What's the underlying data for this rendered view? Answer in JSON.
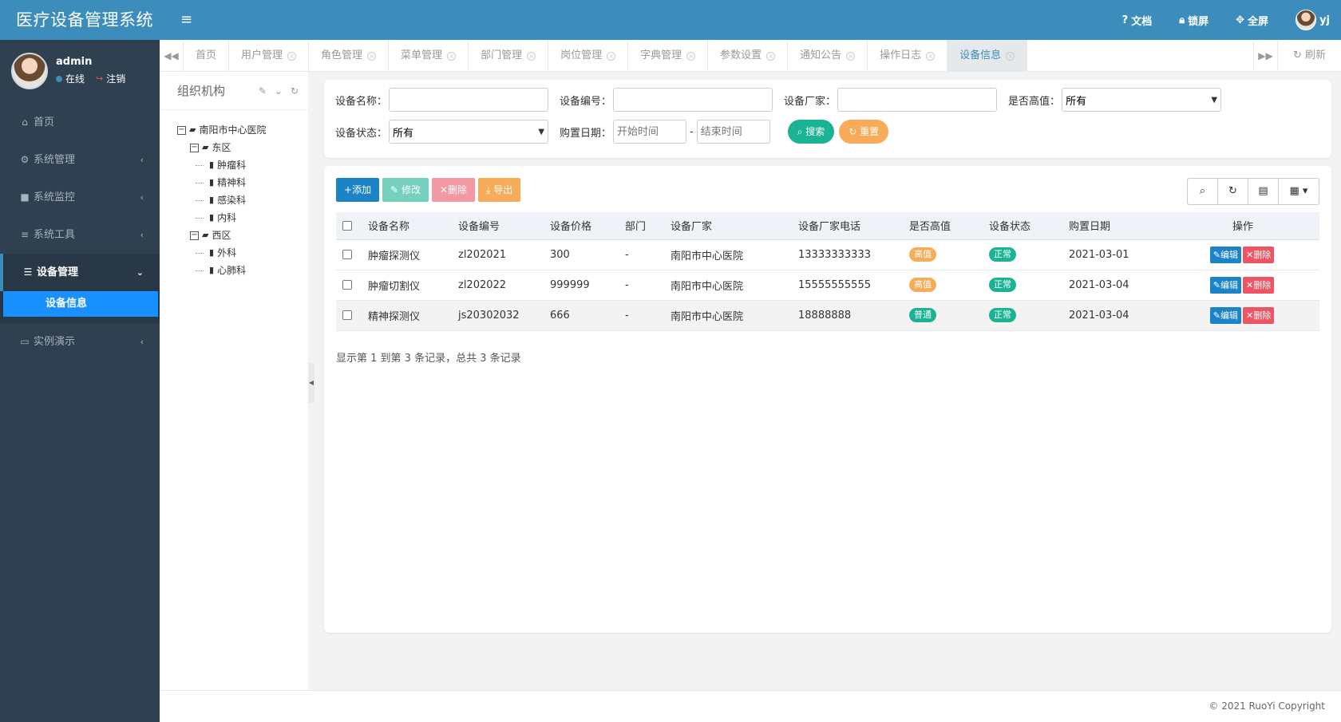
{
  "app": {
    "title": "医疗设备管理系统"
  },
  "user": {
    "name": "admin",
    "status": "在线",
    "logout": "注销",
    "top_name": "yj"
  },
  "topbar": {
    "docs": "文档",
    "lock": "锁屏",
    "fullscreen": "全屏"
  },
  "sidebar": {
    "items": [
      {
        "label": "首页",
        "icon": "home-icon"
      },
      {
        "label": "系统管理",
        "icon": "gear-icon"
      },
      {
        "label": "系统监控",
        "icon": "video-icon"
      },
      {
        "label": "系统工具",
        "icon": "bars-icon"
      },
      {
        "label": "设备管理",
        "icon": "database-icon"
      },
      {
        "label": "实例演示",
        "icon": "desktop-icon"
      }
    ],
    "sub_active": "设备信息"
  },
  "tabs": [
    "首页",
    "用户管理",
    "角色管理",
    "菜单管理",
    "部门管理",
    "岗位管理",
    "字典管理",
    "参数设置",
    "通知公告",
    "操作日志",
    "设备信息"
  ],
  "tabs_refresh": "刷新",
  "tree": {
    "title": "组织机构",
    "root": "南阳市中心医院",
    "groups": [
      {
        "label": "东区",
        "children": [
          "肿瘤科",
          "精神科",
          "感染科",
          "内科"
        ]
      },
      {
        "label": "西区",
        "children": [
          "外科",
          "心肺科"
        ]
      }
    ]
  },
  "search": {
    "device_name_label": "设备名称：",
    "device_code_label": "设备编号：",
    "vendor_label": "设备厂家：",
    "high_value_label": "是否高值：",
    "high_value_selected": "所有",
    "status_label": "设备状态：",
    "status_selected": "所有",
    "purchase_date_label": "购置日期：",
    "start_placeholder": "开始时间",
    "end_placeholder": "结束时间",
    "dash": "-",
    "search_btn": "搜索",
    "reset_btn": "重置"
  },
  "toolbar": {
    "add": "添加",
    "edit": "修改",
    "delete": "删除",
    "export": "导出"
  },
  "table": {
    "headers": [
      "设备名称",
      "设备编号",
      "设备价格",
      "部门",
      "设备厂家",
      "设备厂家电话",
      "是否高值",
      "设备状态",
      "购置日期",
      "操作"
    ],
    "rows": [
      {
        "name": "肿瘤探测仪",
        "code": "zl202021",
        "price": "300",
        "dept": "-",
        "vendor": "南阳市中心医院",
        "phone": "13333333333",
        "high": "高值",
        "status": "正常",
        "date": "2021-03-01"
      },
      {
        "name": "肿瘤切割仪",
        "code": "zl202022",
        "price": "999999",
        "dept": "-",
        "vendor": "南阳市中心医院",
        "phone": "15555555555",
        "high": "高值",
        "status": "正常",
        "date": "2021-03-04"
      },
      {
        "name": "精神探测仪",
        "code": "js20302032",
        "price": "666",
        "dept": "-",
        "vendor": "南阳市中心医院",
        "phone": "18888888",
        "high": "普通",
        "status": "正常",
        "date": "2021-03-04"
      }
    ],
    "edit_label": "编辑",
    "delete_label": "删除",
    "pager": "显示第 1 到第 3 条记录，总共 3 条记录"
  },
  "footer": {
    "copyright": "© 2021 RuoYi Copyright"
  },
  "colors": {
    "brand": "#3c8dbc",
    "sidebar": "#2f4050",
    "active_sub": "#1890ff",
    "success": "#1ab394",
    "warning": "#f8ac59",
    "danger": "#ed5565",
    "primary": "#1c84c6"
  }
}
